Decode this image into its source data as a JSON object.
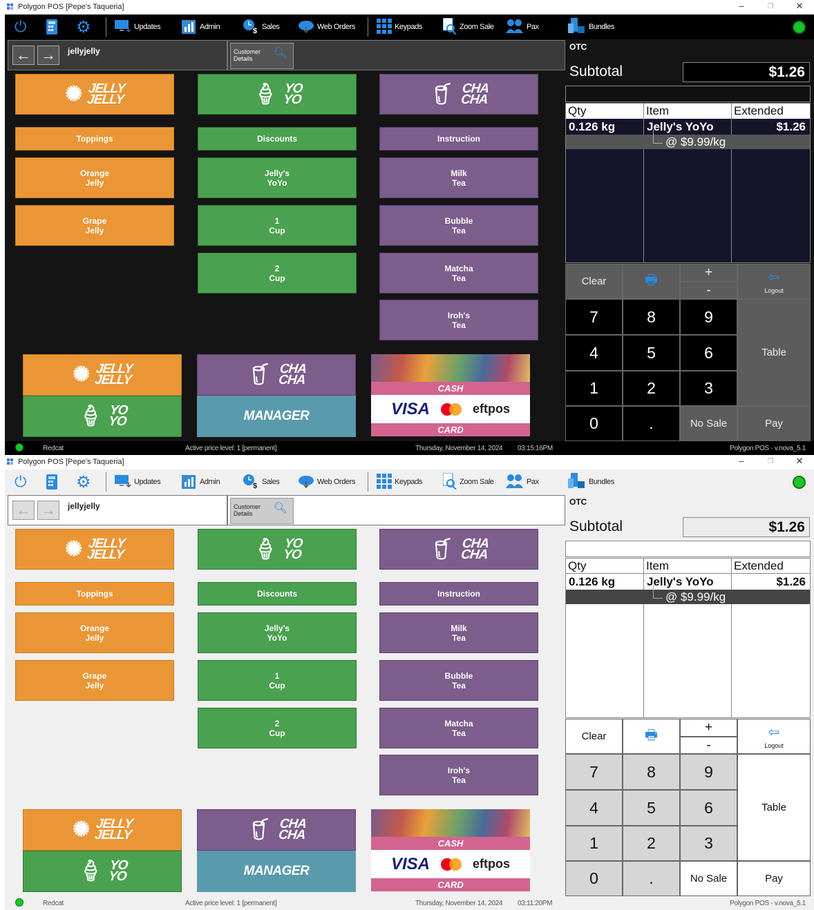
{
  "window": {
    "title": "Polygon POS  [Pepe's Taqueria]",
    "controls": [
      "–",
      "❐",
      "✕"
    ]
  },
  "toolbar": {
    "updates": "Updates",
    "admin": "Admin",
    "sales": "Sales",
    "web_orders": "Web Orders",
    "keypads": "Keypads",
    "zoom_sale": "Zoom Sale",
    "pax": "Pax",
    "bundles": "Bundles"
  },
  "nav": {
    "back": "←",
    "forward": "→",
    "username": "jellyjelly"
  },
  "customer_details": {
    "label_line1": "Customer",
    "label_line2": "Details"
  },
  "logos": {
    "jelly": "JELLY\nJELLY",
    "yoyo": "YO\nYO",
    "chacha": "CHA\nCHA"
  },
  "columns": {
    "col1": [
      "Toppings",
      "Orange\nJelly",
      "Grape\nJelly"
    ],
    "col2": [
      "Discounts",
      "Jelly's\nYoYo",
      "1\nCup",
      "2\nCup"
    ],
    "col3": [
      "Instruction",
      "Milk\nTea",
      "Bubble\nTea",
      "Matcha\nTea",
      "Iroh's\nTea"
    ]
  },
  "bottom": {
    "manager": "MANAGER",
    "cash": "CASH",
    "visa": "VISA",
    "eftpos": "eftpos",
    "card": "CARD"
  },
  "order": {
    "otc": "OTC",
    "subtotal_label": "Subtotal",
    "subtotal_value": "$1.26",
    "headers": [
      "Qty",
      "Item",
      "Extended"
    ],
    "row": {
      "qty": "0.126 kg",
      "item": "Jelly's YoYo",
      "extended": "$1.26",
      "modifier": "@ $9.99/kg"
    }
  },
  "keypad": {
    "clear": "Clear",
    "plus": "+",
    "minus": "-",
    "logout": "Logout",
    "digits": [
      "7",
      "8",
      "9",
      "4",
      "5",
      "6",
      "1",
      "2",
      "3",
      "0",
      "."
    ],
    "table": "Table",
    "no_sale": "No Sale",
    "pay": "Pay"
  },
  "status": {
    "vendor": "Redcat",
    "price_level": "Active price level: 1 [permanent]",
    "date": "Thursday, November 14, 2024",
    "time_dark": "03:15:16PM",
    "time_light": "03:11:20PM",
    "version": "Polygon POS - v.nova_5.1"
  },
  "colors": {
    "orange": "#ea9636",
    "green": "#4aa150",
    "purple": "#7c5d8c",
    "manager": "#5a9aad",
    "card_pink": "#d36490",
    "status_green": "#1dc42a"
  }
}
